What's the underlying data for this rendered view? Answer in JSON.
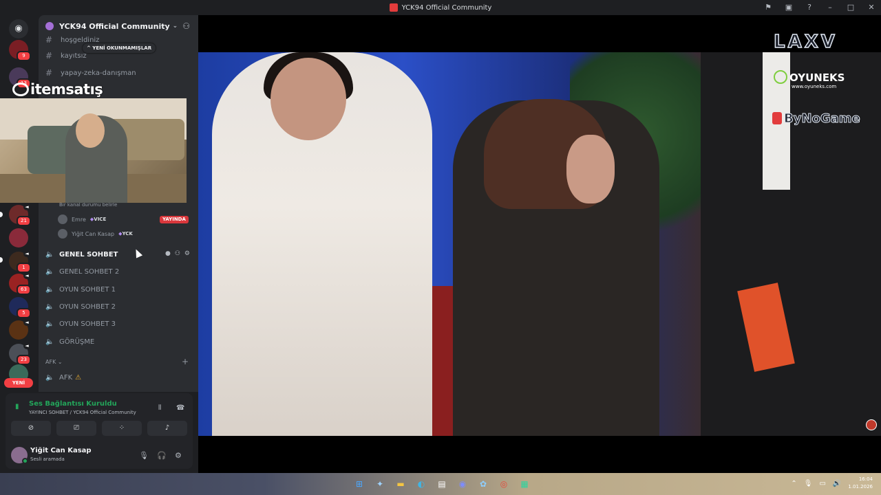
{
  "window": {
    "title": "YCK94 Official Community"
  },
  "rail": {
    "badges": [
      "9",
      "13",
      "21",
      "1",
      "63",
      "5",
      "23"
    ],
    "new_label": "YENİ"
  },
  "guild": {
    "name": "YCK94 Official Community",
    "unread_pill": "^ YENİ OKUNMAMIŞLAR"
  },
  "channels_text": [
    {
      "name": "hoşgeldiniz"
    },
    {
      "name": "kayıtsız"
    },
    {
      "name": "yapay-zeka-danışman"
    }
  ],
  "voice": {
    "status_hint": "Bir kanal durumu belirle",
    "users": [
      {
        "name": "Emre",
        "tag": "VICE",
        "live": "YAYINDA"
      },
      {
        "name": "Yiğit Can Kasap",
        "tag": "YCK"
      }
    ],
    "channels": [
      {
        "name": "GENEL SOHBET"
      },
      {
        "name": "GENEL SOHBET 2"
      },
      {
        "name": "OYUN SOHBET 1"
      },
      {
        "name": "OYUN SOHBET 2"
      },
      {
        "name": "OYUN SOHBET 3"
      },
      {
        "name": "GÖRÜŞME"
      }
    ],
    "category": "AFK",
    "afk_channel": "AFK"
  },
  "overlay": {
    "brand": "itemsatış"
  },
  "connection": {
    "status": "Ses Bağlantısı Kuruldu",
    "channel": "YAYINCI SOHBET / YCK94 Official Community"
  },
  "user": {
    "name": "Yiğit Can Kasap",
    "status": "Sesli aramada"
  },
  "stream": {
    "sponsor_1": "LAXV",
    "sponsor_2": "OYUNEKS",
    "sponsor_2_url": "www.oyuneks.com",
    "sponsor_3": "ByNoGame"
  },
  "taskbar": {
    "time": "16:04",
    "date": "1.01.2026"
  },
  "colors": {
    "accent_green": "#23a55a",
    "live_red": "#da373c",
    "sidebar_bg": "#2b2d31"
  }
}
